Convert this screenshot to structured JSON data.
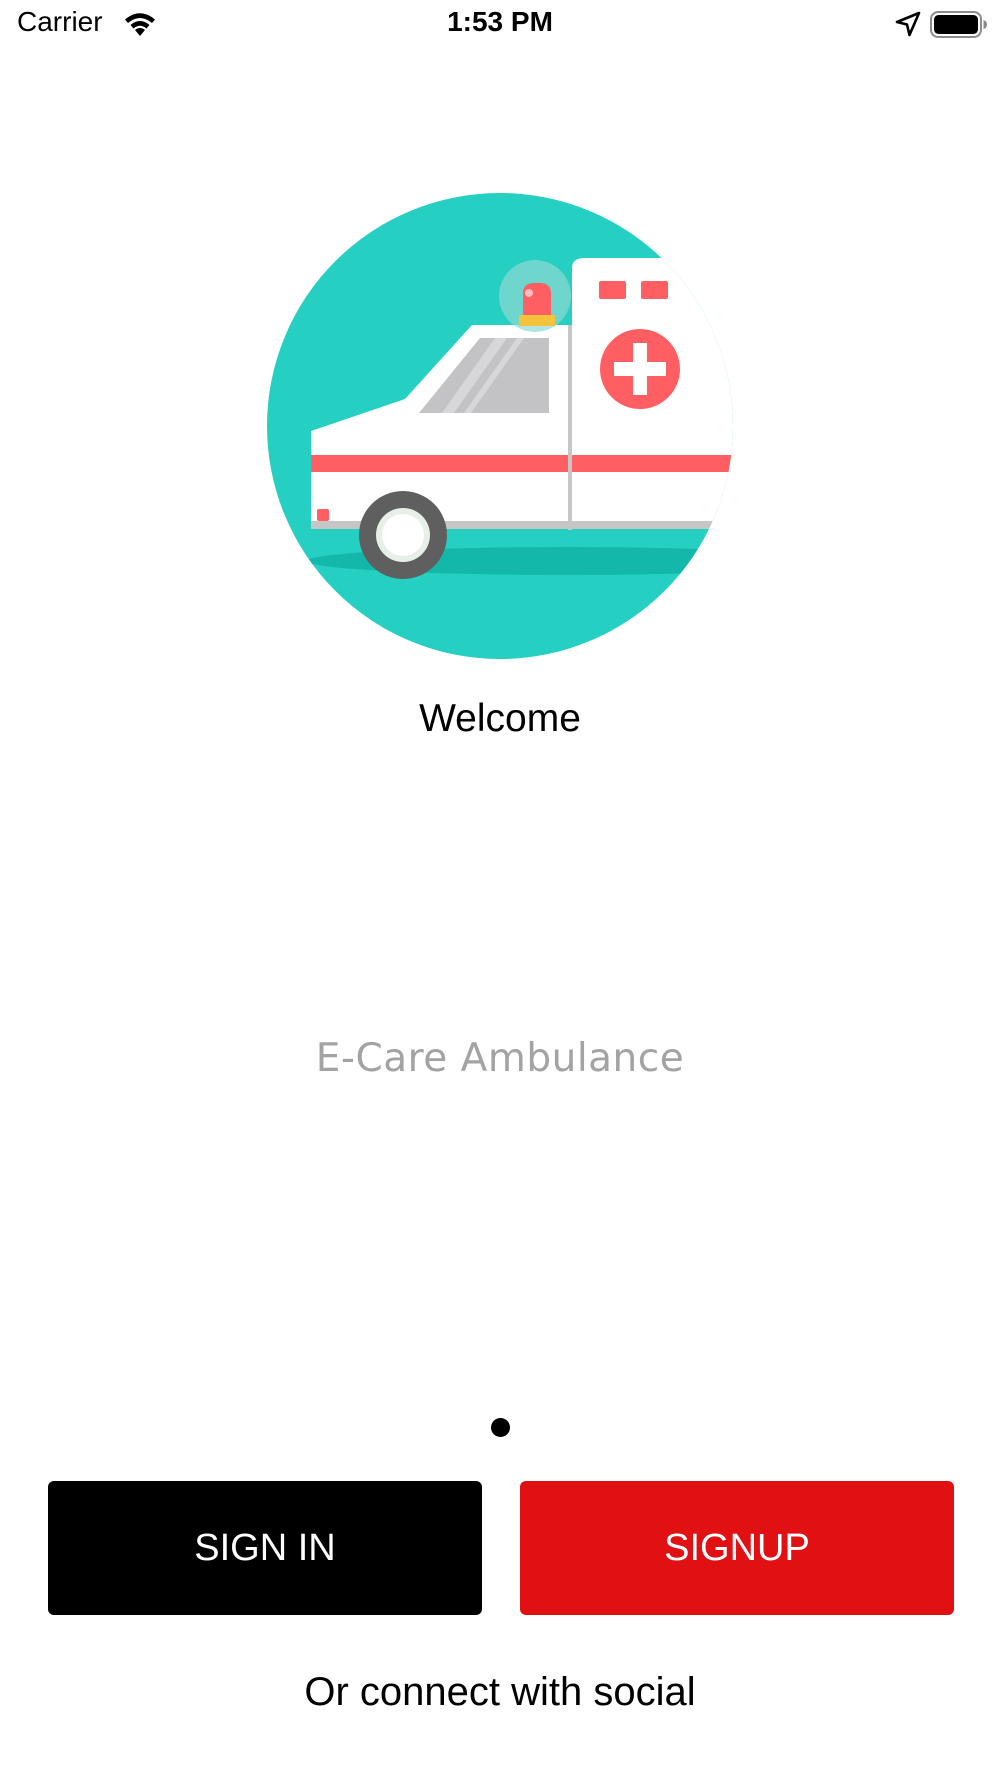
{
  "status_bar": {
    "carrier": "Carrier",
    "time": "1:53 PM",
    "icons": [
      "wifi-icon",
      "location-arrow-icon",
      "battery-icon"
    ]
  },
  "hero": {
    "illustration": "ambulance-illustration",
    "circle_color": "#25d0c3",
    "accent_red": "#ff5e62"
  },
  "welcome_text": "Welcome",
  "app_name": "E-Care Ambulance",
  "pager": {
    "current_page": 1,
    "total_pages": 1
  },
  "buttons": {
    "sign_in": "SIGN IN",
    "sign_up": "SIGNUP",
    "sign_in_color": "#000000",
    "sign_up_color": "#e01013"
  },
  "social_text": "Or connect with social"
}
